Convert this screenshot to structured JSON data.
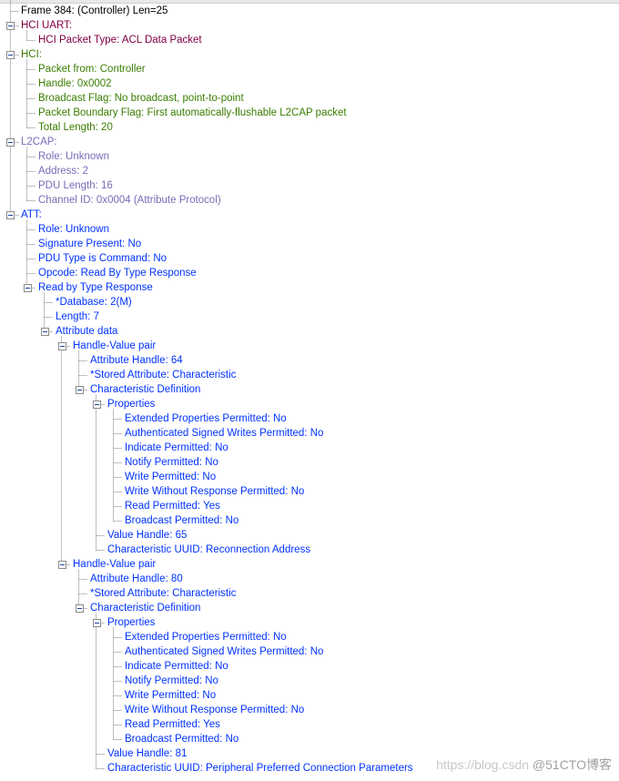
{
  "colors": {
    "frame": "#000000",
    "uart": "#800040",
    "hci": "#3a7d00",
    "l2cap": "#7a6ab8",
    "att": "#0033ff"
  },
  "watermark": {
    "url": "https://blog.csdn",
    "brand": "@51CTO博客"
  },
  "nodes": [
    {
      "level": 0,
      "text": "Frame 384: (Controller) Len=25",
      "group": "frame"
    },
    {
      "level": 0,
      "text": "HCI UART:",
      "group": "uart",
      "expanded": true
    },
    {
      "level": 1,
      "text": "HCI Packet Type: ACL Data Packet",
      "group": "uart"
    },
    {
      "level": 0,
      "text": "HCI:",
      "group": "hci",
      "expanded": true
    },
    {
      "level": 1,
      "text": "Packet from: Controller",
      "group": "hci"
    },
    {
      "level": 1,
      "text": "Handle: 0x0002",
      "group": "hci"
    },
    {
      "level": 1,
      "text": "Broadcast Flag: No broadcast, point-to-point",
      "group": "hci"
    },
    {
      "level": 1,
      "text": "Packet Boundary Flag: First automatically-flushable L2CAP packet",
      "group": "hci"
    },
    {
      "level": 1,
      "text": "Total Length: 20",
      "group": "hci"
    },
    {
      "level": 0,
      "text": "L2CAP:",
      "group": "l2cap",
      "expanded": true
    },
    {
      "level": 1,
      "text": "Role: Unknown",
      "group": "l2cap"
    },
    {
      "level": 1,
      "text": "Address: 2",
      "group": "l2cap"
    },
    {
      "level": 1,
      "text": "PDU Length: 16",
      "group": "l2cap"
    },
    {
      "level": 1,
      "text": "Channel ID: 0x0004  (Attribute Protocol)",
      "group": "l2cap"
    },
    {
      "level": 0,
      "text": "ATT:",
      "group": "att",
      "expanded": true
    },
    {
      "level": 1,
      "text": "Role: Unknown",
      "group": "att"
    },
    {
      "level": 1,
      "text": "Signature Present: No",
      "group": "att"
    },
    {
      "level": 1,
      "text": "PDU Type is Command: No",
      "group": "att"
    },
    {
      "level": 1,
      "text": "Opcode: Read By Type Response",
      "group": "att"
    },
    {
      "level": 1,
      "text": "Read by Type Response",
      "group": "att",
      "expanded": true
    },
    {
      "level": 2,
      "text": "*Database: 2(M)",
      "group": "att"
    },
    {
      "level": 2,
      "text": "Length: 7",
      "group": "att"
    },
    {
      "level": 2,
      "text": "Attribute data",
      "group": "att",
      "expanded": true
    },
    {
      "level": 3,
      "text": "Handle-Value pair",
      "group": "att",
      "expanded": true
    },
    {
      "level": 4,
      "text": "Attribute Handle: 64",
      "group": "att"
    },
    {
      "level": 4,
      "text": "*Stored Attribute: Characteristic",
      "group": "att"
    },
    {
      "level": 4,
      "text": "Characteristic Definition",
      "group": "att",
      "expanded": true
    },
    {
      "level": 5,
      "text": "Properties",
      "group": "att",
      "expanded": true
    },
    {
      "level": 6,
      "text": "Extended Properties Permitted: No",
      "group": "att"
    },
    {
      "level": 6,
      "text": "Authenticated Signed Writes Permitted: No",
      "group": "att"
    },
    {
      "level": 6,
      "text": "Indicate Permitted: No",
      "group": "att"
    },
    {
      "level": 6,
      "text": "Notify Permitted: No",
      "group": "att"
    },
    {
      "level": 6,
      "text": "Write Permitted: No",
      "group": "att"
    },
    {
      "level": 6,
      "text": "Write Without Response Permitted: No",
      "group": "att"
    },
    {
      "level": 6,
      "text": "Read Permitted: Yes",
      "group": "att"
    },
    {
      "level": 6,
      "text": "Broadcast Permitted: No",
      "group": "att"
    },
    {
      "level": 5,
      "text": "Value Handle: 65",
      "group": "att"
    },
    {
      "level": 5,
      "text": "Characteristic UUID: Reconnection Address",
      "group": "att"
    },
    {
      "level": 3,
      "text": "Handle-Value pair",
      "group": "att",
      "expanded": true
    },
    {
      "level": 4,
      "text": "Attribute Handle: 80",
      "group": "att"
    },
    {
      "level": 4,
      "text": "*Stored Attribute: Characteristic",
      "group": "att"
    },
    {
      "level": 4,
      "text": "Characteristic Definition",
      "group": "att",
      "expanded": true
    },
    {
      "level": 5,
      "text": "Properties",
      "group": "att",
      "expanded": true
    },
    {
      "level": 6,
      "text": "Extended Properties Permitted: No",
      "group": "att"
    },
    {
      "level": 6,
      "text": "Authenticated Signed Writes Permitted: No",
      "group": "att"
    },
    {
      "level": 6,
      "text": "Indicate Permitted: No",
      "group": "att"
    },
    {
      "level": 6,
      "text": "Notify Permitted: No",
      "group": "att"
    },
    {
      "level": 6,
      "text": "Write Permitted: No",
      "group": "att"
    },
    {
      "level": 6,
      "text": "Write Without Response Permitted: No",
      "group": "att"
    },
    {
      "level": 6,
      "text": "Read Permitted: Yes",
      "group": "att"
    },
    {
      "level": 6,
      "text": "Broadcast Permitted: No",
      "group": "att"
    },
    {
      "level": 5,
      "text": "Value Handle: 81",
      "group": "att"
    },
    {
      "level": 5,
      "text": "Characteristic UUID: Peripheral Preferred Connection Parameters",
      "group": "att"
    }
  ]
}
